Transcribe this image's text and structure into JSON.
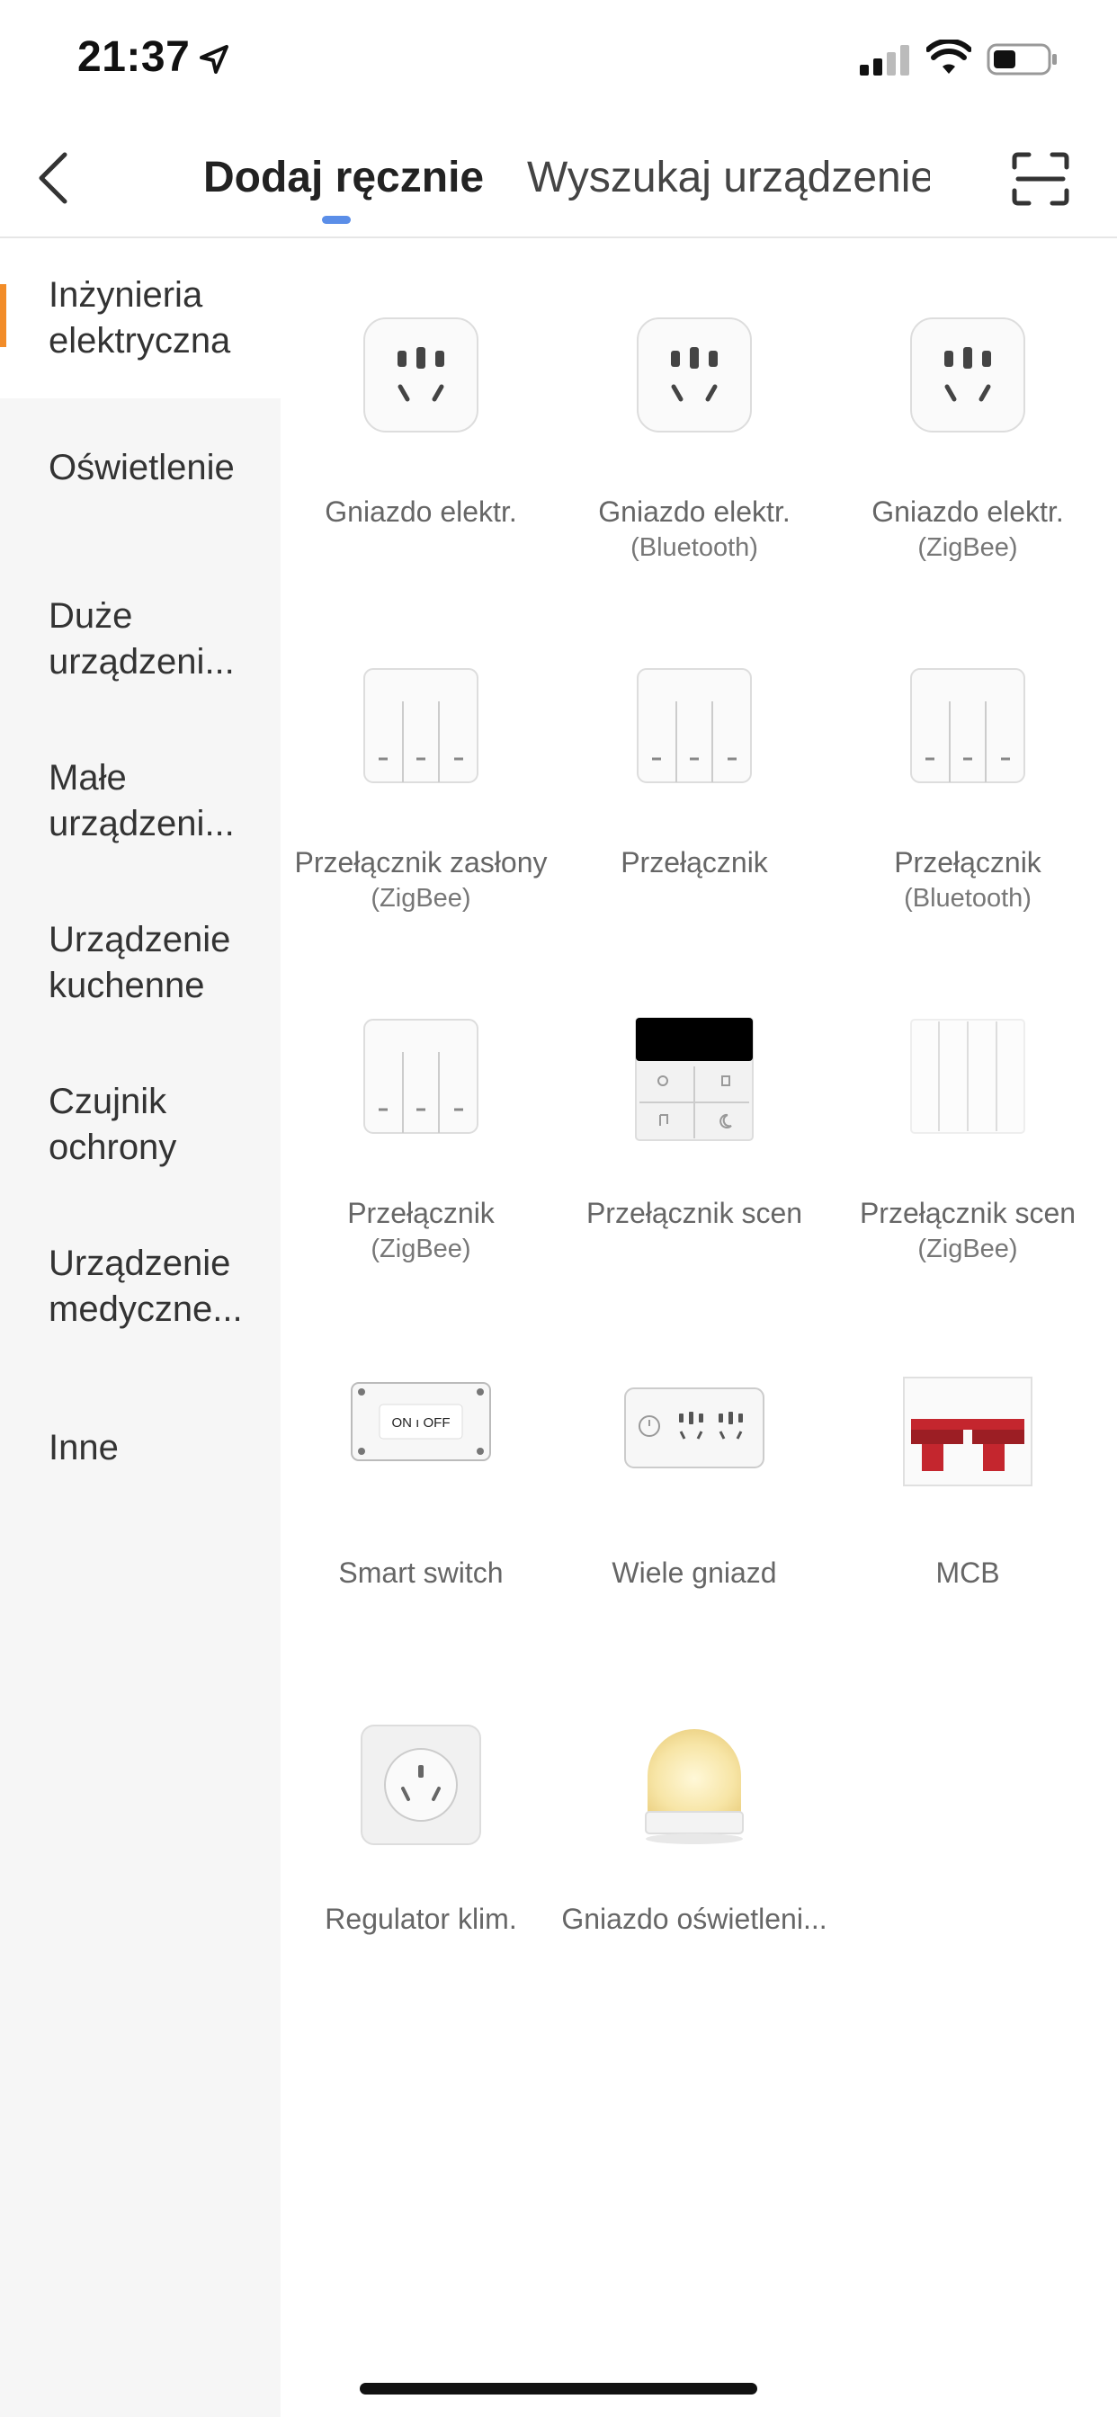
{
  "status_bar": {
    "time": "21:37"
  },
  "header": {
    "tab_manual": "Dodaj ręcznie",
    "tab_search": "Wyszukaj urządzenie",
    "accent": "#5b8ee8"
  },
  "sidebar": {
    "accent": "#f28c28",
    "items": [
      {
        "label": "Inżynieria elektryczna",
        "active": true
      },
      {
        "label": "Oświetlenie"
      },
      {
        "label": "Duże urządzeni..."
      },
      {
        "label": "Małe urządzeni..."
      },
      {
        "label": "Urządzenie kuchenne"
      },
      {
        "label": "Czujnik ochrony"
      },
      {
        "label": "Urządzenie medyczne..."
      },
      {
        "label": "Inne"
      }
    ]
  },
  "devices": [
    {
      "name": "Gniazdo elektr.",
      "sub": "",
      "icon": "socket-icon"
    },
    {
      "name": "Gniazdo elektr.",
      "sub": "(Bluetooth)",
      "icon": "socket-icon"
    },
    {
      "name": "Gniazdo elektr.",
      "sub": "(ZigBee)",
      "icon": "socket-icon"
    },
    {
      "name": "Przełącznik zasłony",
      "sub": "(ZigBee)",
      "icon": "wall-switch-icon"
    },
    {
      "name": "Przełącznik",
      "sub": "",
      "icon": "wall-switch-icon"
    },
    {
      "name": "Przełącznik",
      "sub": "(Bluetooth)",
      "icon": "wall-switch-icon"
    },
    {
      "name": "Przełącznik",
      "sub": "(ZigBee)",
      "icon": "wall-switch-icon"
    },
    {
      "name": "Przełącznik scen",
      "sub": "",
      "icon": "scene-switch-icon"
    },
    {
      "name": "Przełącznik scen",
      "sub": "(ZigBee)",
      "icon": "scene-panel-icon"
    },
    {
      "name": "Smart switch",
      "sub": "",
      "icon": "smart-switch-icon",
      "icon_text": "ON ı OFF"
    },
    {
      "name": "Wiele gniazd",
      "sub": "",
      "icon": "power-strip-icon"
    },
    {
      "name": "MCB",
      "sub": "",
      "icon": "mcb-breaker-icon"
    },
    {
      "name": "Regulator klim.",
      "sub": "",
      "icon": "ac-regulator-icon"
    },
    {
      "name": "Gniazdo oświetleni...",
      "sub": "",
      "icon": "light-socket-icon"
    }
  ]
}
